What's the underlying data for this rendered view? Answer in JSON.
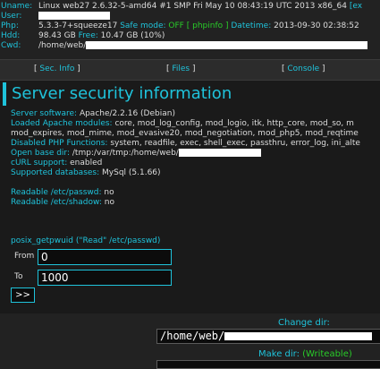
{
  "server_info": {
    "uname_label": "Uname:",
    "uname_value": "Linux web27 2.6.32-5-amd64 #1 SMP Fri May 10 08:43:19 UTC 2013 x86_64",
    "uname_link": "[ex",
    "user_label": "User:",
    "php_label": "Php:",
    "php_version": "5.3.3-7+squeeze17",
    "safe_mode_label": "Safe mode:",
    "safe_mode_value": "OFF",
    "phpinfo_link": "[ phpinfo ]",
    "datetime_label": "Datetime:",
    "datetime_value": "2013-09-30 02:38:52",
    "hdd_label": "Hdd:",
    "hdd_total": "98.43 GB",
    "free_label": "Free:",
    "hdd_free": "10.47 GB (10%)",
    "cwd_label": "Cwd:",
    "cwd_value": "/home/web/"
  },
  "nav": {
    "sec_info": "Sec. Info",
    "files": "Files",
    "console": "Console"
  },
  "section": {
    "title": "Server security information",
    "software_label": "Server software:",
    "software_value": "Apache/2.2.16 (Debian)",
    "modules_label": "Loaded Apache modules:",
    "modules_line1": "core, mod_log_config, mod_logio, itk, http_core, mod_so, m",
    "modules_line2": "mod_expires, mod_mime, mod_evasive20, mod_negotiation, mod_php5, mod_reqtime",
    "disabled_label": "Disabled PHP Functions:",
    "disabled_value": "system, readfile, exec, shell_exec, passthru, error_log, ini_alte",
    "openbase_label": "Open base dir:",
    "openbase_value": "/tmp:/var/tmp:/home/web/",
    "curl_label": "cURL support:",
    "curl_value": "enabled",
    "db_label": "Supported databases:",
    "db_value": "MySql (5.1.66)",
    "passwd_label": "Readable /etc/passwd:",
    "passwd_value": "no",
    "shadow_label": "Readable /etc/shadow:",
    "shadow_value": "no",
    "posix_label": "posix_getpwuid (\"Read\" /etc/passwd)",
    "from_label": "From",
    "from_value": "0",
    "to_label": "To",
    "to_value": "1000",
    "go_label": ">>"
  },
  "footer": {
    "change_dir_label": "Change dir:",
    "change_dir_value": "/home/web/",
    "make_dir_label": "Make dir:",
    "make_dir_status": "(Writeable)"
  },
  "colors": {
    "accent": "#1fc3db",
    "ok": "#29cc29",
    "background": "#222222"
  }
}
